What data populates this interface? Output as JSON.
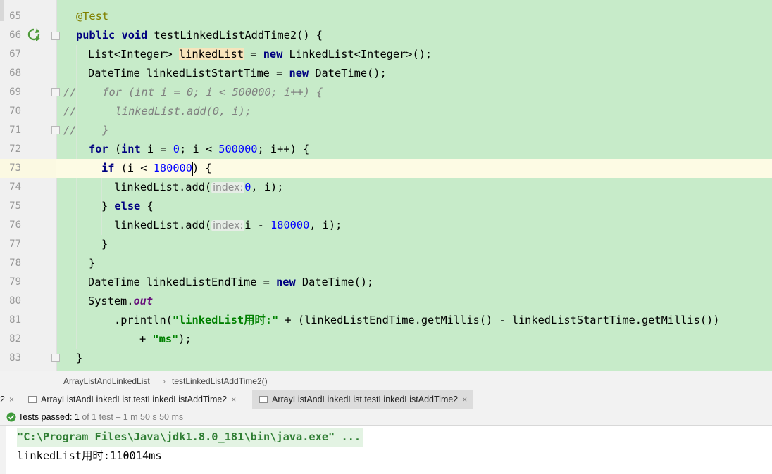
{
  "editor": {
    "line_numbers": [
      "65",
      "66",
      "67",
      "68",
      "69",
      "70",
      "71",
      "72",
      "73",
      "74",
      "75",
      "76",
      "77",
      "78",
      "79",
      "80",
      "81",
      "82",
      "83"
    ],
    "lines": {
      "l65": {
        "ann": "@Test"
      },
      "l66": {
        "kw1": "public",
        "kw2": "void",
        "rest": " testLinkedListAddTime2() {"
      },
      "l67": {
        "a": "List<Integer> ",
        "hl": "linkedList",
        "b": " = ",
        "kw": "new",
        "c": " LinkedList<Integer>();"
      },
      "l68": {
        "a": "DateTime linkedListStartTime = ",
        "kw": "new",
        "b": " DateTime();"
      },
      "l69": {
        "comment": "//    for (int i = 0; i < 500000; i++) {"
      },
      "l70": {
        "comment": "//      linkedList.add(0, i);"
      },
      "l71": {
        "comment": "//    }"
      },
      "l72": {
        "kw1": "for",
        "a": " (",
        "kw2": "int",
        "b": " i = ",
        "n1": "0",
        "c": "; i < ",
        "n2": "500000",
        "d": "; i++) {"
      },
      "l73": {
        "kw": "if",
        "a": " (i < ",
        "n1": "180000",
        "b": ") {"
      },
      "l74": {
        "a": "linkedList.add(",
        "hint": "index:",
        "n1": "0",
        "b": ", i);"
      },
      "l75": {
        "a": "} ",
        "kw": "else",
        "b": " {"
      },
      "l76": {
        "a": "linkedList.add(",
        "hint": "index:",
        "b": "i - ",
        "n1": "180000",
        "c": ", i);"
      },
      "l77": {
        "a": "}"
      },
      "l78": {
        "a": "}"
      },
      "l79": {
        "a": "DateTime linkedListEndTime = ",
        "kw": "new",
        "b": " DateTime();"
      },
      "l80": {
        "a": "System.",
        "fld": "out"
      },
      "l81": {
        "a": ".println(",
        "str": "\"linkedList用时:\"",
        "b": " + (linkedListEndTime.getMillis() - linkedListStartTime.getMillis())"
      },
      "l82": {
        "a": "+ ",
        "str": "\"ms\"",
        "b": ");"
      },
      "l83": {
        "a": "}"
      }
    }
  },
  "breadcrumb": {
    "class_name": "ArrayListAndLinkedList",
    "sep": "›",
    "method_name": "testLinkedListAddTime2()"
  },
  "tabs": {
    "partial_label": "2",
    "items": [
      {
        "label": "ArrayListAndLinkedList.testLinkedListAddTime2",
        "active": false
      },
      {
        "label": "ArrayListAndLinkedList.testLinkedListAddTime2",
        "active": true
      }
    ],
    "close": "×"
  },
  "status": {
    "label": "Tests passed: ",
    "count": "1",
    "detail": " of 1 test – 1 m 50 s 50 ms"
  },
  "console": {
    "cmd": "\"C:\\Program Files\\Java\\jdk1.8.0_181\\bin\\java.exe\" ...",
    "output": "linkedList用时:110014ms"
  },
  "colors": {
    "editor_bg": "#c7ebc9",
    "current_line": "#fdfbe4",
    "keyword": "#000080",
    "string": "#008000",
    "number": "#0000ff",
    "comment": "#808080"
  }
}
